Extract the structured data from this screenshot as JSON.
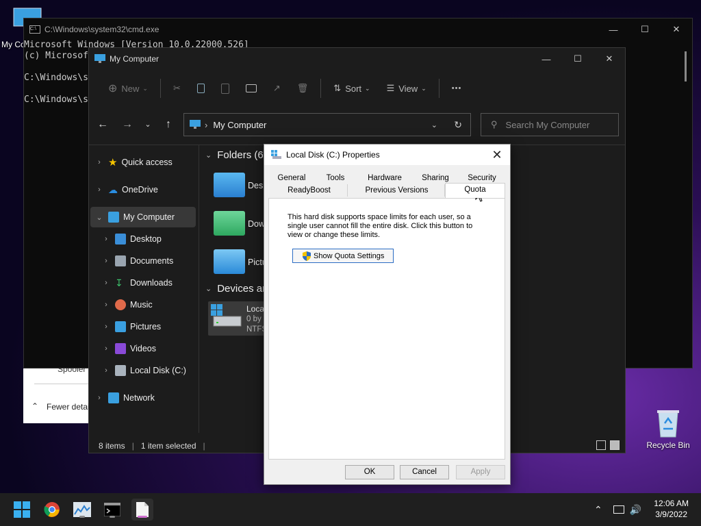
{
  "desktop": {
    "icon_my_computer_label": "My Co",
    "recycle_bin_label": "Recycle Bin"
  },
  "cmd": {
    "title": "C:\\Windows\\system32\\cmd.exe",
    "lines": [
      "Microsoft Windows [Version 10.0.22000.526]",
      "(c) Microsof",
      "",
      "C:\\Windows\\s",
      "",
      "C:\\Windows\\s"
    ]
  },
  "task_manager_fragment": {
    "spooler": "Spooler",
    "fewer_details": "Fewer detai"
  },
  "explorer": {
    "title": "My Computer",
    "toolbar": {
      "new_label": "New",
      "sort_label": "Sort",
      "view_label": "View",
      "more_label": "•••"
    },
    "address": "My Computer",
    "search_placeholder": "Search My Computer",
    "nav": {
      "quick_access": "Quick access",
      "onedrive": "OneDrive",
      "my_computer": "My Computer",
      "desktop": "Desktop",
      "documents": "Documents",
      "downloads": "Downloads",
      "music": "Music",
      "pictures": "Pictures",
      "videos": "Videos",
      "local_disk": "Local Disk (C:)",
      "network": "Network"
    },
    "content": {
      "folders_header": "Folders (6)",
      "folder_desktop": "Desk",
      "folder_downloads": "Dow",
      "folder_pictures": "Pictu",
      "devices_header": "Devices and",
      "drive_name": "Loca",
      "drive_free": "0 by",
      "drive_fs": "NTFS"
    },
    "status": {
      "items": "8 items",
      "selected": "1 item selected"
    }
  },
  "dialog": {
    "title": "Local Disk (C:) Properties",
    "tabs_row1": [
      "General",
      "Tools",
      "Hardware",
      "Sharing",
      "Security"
    ],
    "tabs_row2": [
      "ReadyBoost",
      "Previous Versions",
      "Quota"
    ],
    "active_tab": "Quota",
    "description": "This hard disk supports space limits for each user, so a single user cannot fill the entire disk. Click this button to view or change these limits.",
    "show_quota_button": "Show Quota Settings",
    "ok": "OK",
    "cancel": "Cancel",
    "apply": "Apply"
  },
  "taskbar": {
    "time": "12:06 AM",
    "date": "3/9/2022"
  },
  "colors": {
    "accent": "#0078d4",
    "dialog_button_border": "#2a6cc4"
  }
}
